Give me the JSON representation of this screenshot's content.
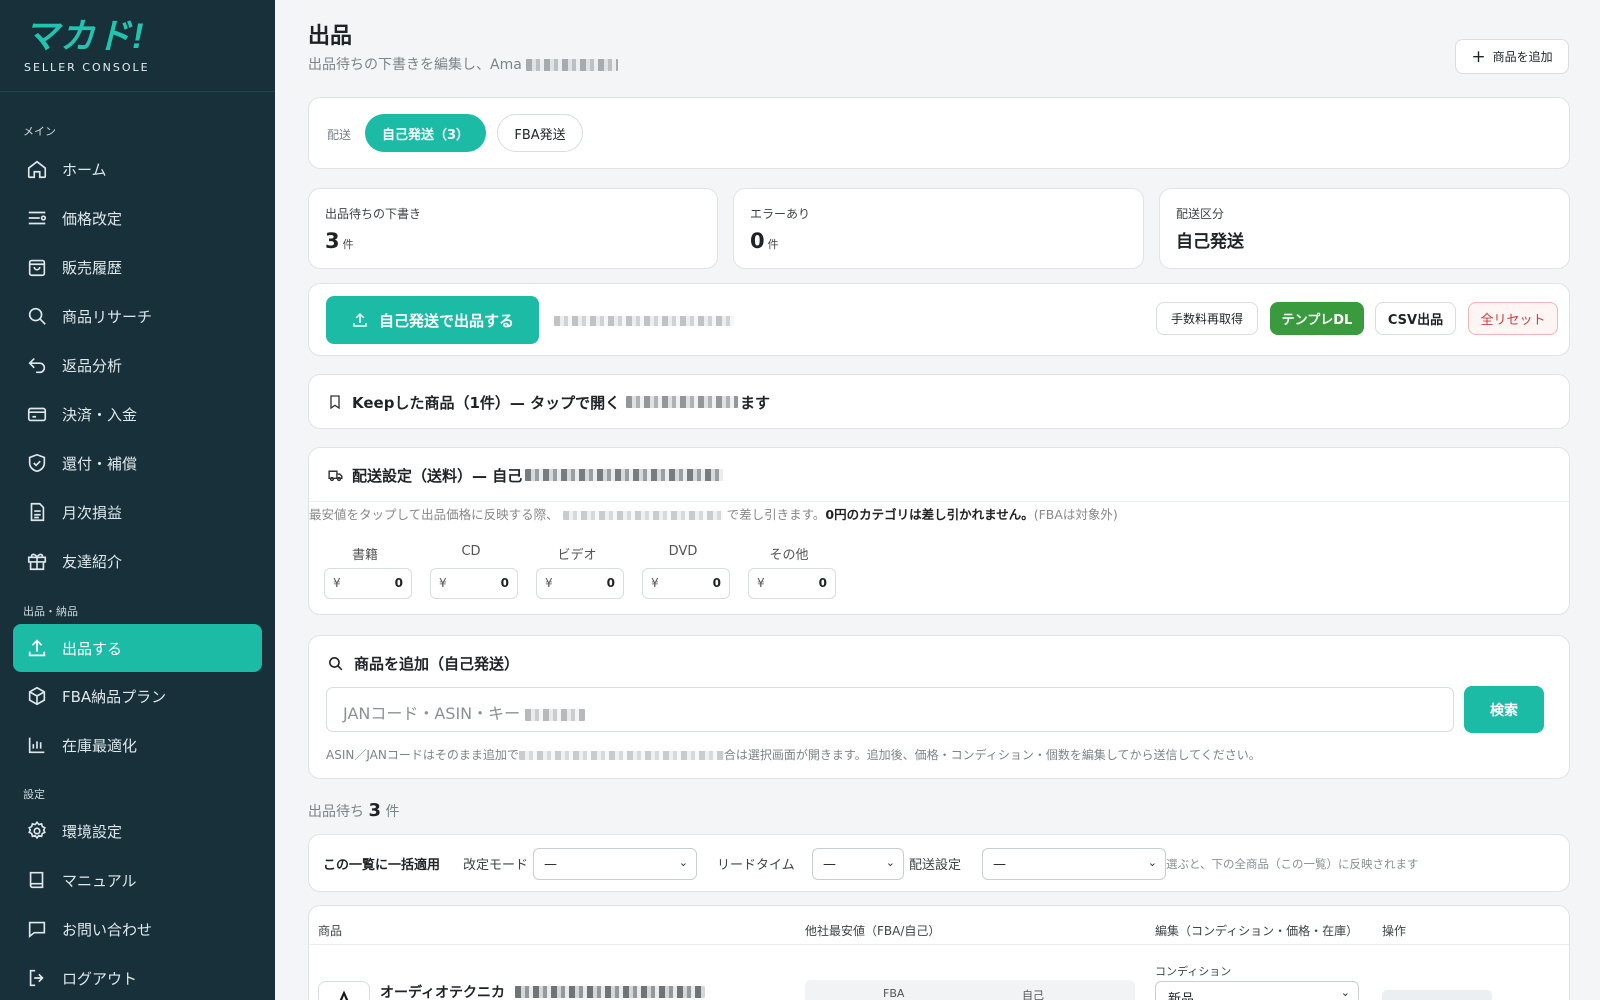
{
  "sidebar": {
    "logo": "マカド!",
    "logo_sub": "SELLER CONSOLE",
    "sections": {
      "main": "メイン",
      "listing": "出品・納品",
      "settings": "設定"
    },
    "items": [
      {
        "label": "ホーム",
        "icon": "home-icon"
      },
      {
        "label": "価格改定",
        "icon": "list-icon"
      },
      {
        "label": "販売履歴",
        "icon": "bag-icon"
      },
      {
        "label": "商品リサーチ",
        "icon": "search-icon"
      },
      {
        "label": "返品分析",
        "icon": "return-icon"
      },
      {
        "label": "決済・入金",
        "icon": "card-icon"
      },
      {
        "label": "還付・補償",
        "icon": "shield-icon"
      },
      {
        "label": "月次損益",
        "icon": "document-icon"
      },
      {
        "label": "友達紹介",
        "icon": "gift-icon"
      },
      {
        "label": "出品する",
        "icon": "upload-icon"
      },
      {
        "label": "FBA納品プラン",
        "icon": "box-icon"
      },
      {
        "label": "在庫最適化",
        "icon": "chart-icon"
      },
      {
        "label": "環境設定",
        "icon": "gear-icon"
      },
      {
        "label": "マニュアル",
        "icon": "book-icon"
      },
      {
        "label": "お問い合わせ",
        "icon": "chat-icon"
      },
      {
        "label": "ログアウト",
        "icon": "logout-icon"
      }
    ]
  },
  "header": {
    "title": "出品",
    "subtitle": "出品待ちの下書きを編集し、Ama",
    "add_button": "商品を追加"
  },
  "shipping_tabs": {
    "label": "配送",
    "self": "自己発送（3）",
    "fba": "FBA発送"
  },
  "stats": [
    {
      "label": "出品待ちの下書き",
      "value": "3",
      "unit": "件"
    },
    {
      "label": "エラーあり",
      "value": "0",
      "unit": "件"
    },
    {
      "label": "配送区分",
      "value": "自己発送",
      "unit": ""
    }
  ],
  "actions": {
    "primary": "自己発送で出品する",
    "refetch": "手数料再取得",
    "template": "テンプレDL",
    "csv": "CSV出品",
    "reset": "全リセット"
  },
  "keep": {
    "text": "Keepした商品（1件）— タップで開く",
    "suffix": "ます"
  },
  "shipping_settings": {
    "title": "配送設定（送料）— 自己",
    "note_a": "最安値をタップして出品価格に反映する際、",
    "note_b": "で差し引きます。",
    "note_bold": "0円のカテゴリは差し引かれません。",
    "note_c": "(FBAは対象外)",
    "currency": "¥",
    "categories": [
      {
        "label": "書籍",
        "value": "0"
      },
      {
        "label": "CD",
        "value": "0"
      },
      {
        "label": "ビデオ",
        "value": "0"
      },
      {
        "label": "DVD",
        "value": "0"
      },
      {
        "label": "その他",
        "value": "0"
      }
    ]
  },
  "add_product": {
    "title": "商品を追加（自己発送）",
    "placeholder": "JANコード・ASIN・キー",
    "search": "検索",
    "help_a": "ASIN／JANコードはそのまま追加で",
    "help_b": "合は選択画面が開きます。追加後、価格・コンディション・個数を編集してから送信してください。"
  },
  "pending": {
    "label": "出品待ち",
    "count": "3",
    "unit": "件"
  },
  "bulk": {
    "title": "この一覧に一括適用",
    "mode_label": "改定モード",
    "mode_value": "—",
    "lead_label": "リードタイム",
    "lead_value": "—",
    "ship_label": "配送設定",
    "ship_value": "—",
    "hint": "選ぶと、下の全商品（この一覧）に反映されます"
  },
  "table": {
    "headers": [
      "商品",
      "他社最安値（FBA/自己）",
      "編集（コンディション・価格・在庫）",
      "操作"
    ],
    "row": {
      "name": "オーディオテクニカ",
      "fba": "FBA",
      "self": "自己",
      "condition_label": "コンディション",
      "condition_value": "新品"
    }
  },
  "colors": {
    "sidebar": "#17303a",
    "accent": "#1bbba5",
    "green": "#3a9a3e",
    "danger": "#d33a3a"
  }
}
